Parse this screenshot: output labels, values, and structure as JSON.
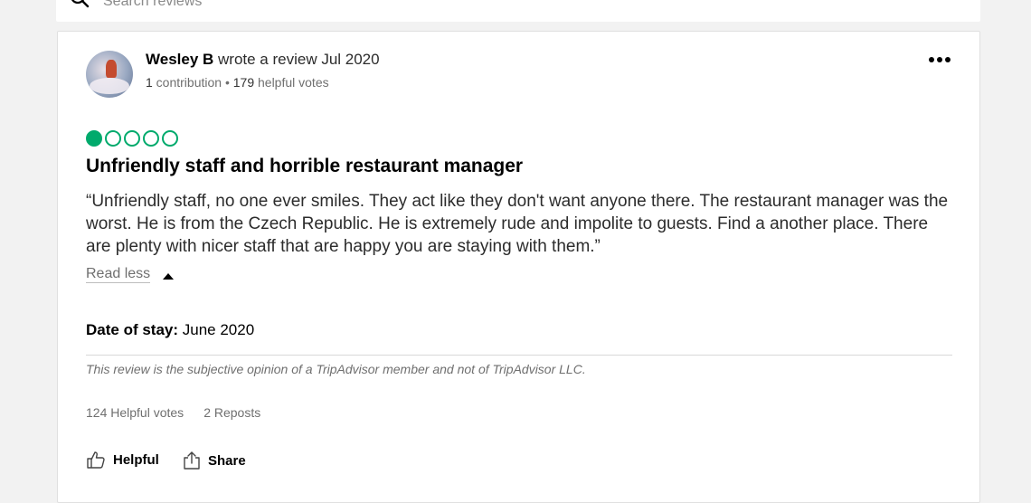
{
  "search": {
    "placeholder": "Search reviews"
  },
  "review": {
    "username": "Wesley B",
    "wrote_text": " wrote a review Jul 2020",
    "contributions": "1",
    "contributions_label": " contribution • ",
    "helpful_votes": "179",
    "helpful_votes_label": " helpful votes",
    "rating": 1,
    "rating_max": 5,
    "title": "Unfriendly staff and horrible restaurant manager",
    "text": "“Unfriendly staff, no one ever smiles. They act like they don't want anyone there. The restaurant manager was the worst. He is from the Czech Republic. He is extremely rude and impolite to guests. Find a another place. There are plenty with nicer staff that are happy you are staying with them.”",
    "read_less": "Read less",
    "date_of_stay_label": "Date of stay:",
    "date_of_stay_value": " June 2020",
    "disclaimer": "This review is the subjective opinion of a TripAdvisor member and not of TripAdvisor LLC.",
    "votes_text": "124 Helpful votes",
    "reposts_text": "2 Reposts",
    "helpful_button": "Helpful",
    "share_button": "Share"
  },
  "colors": {
    "accent": "#00aa6c"
  },
  "icons": {
    "search": "search-icon",
    "more": "more-icon",
    "caret": "caret-up-icon",
    "helpful": "thumbs-up-icon",
    "share": "share-icon"
  }
}
